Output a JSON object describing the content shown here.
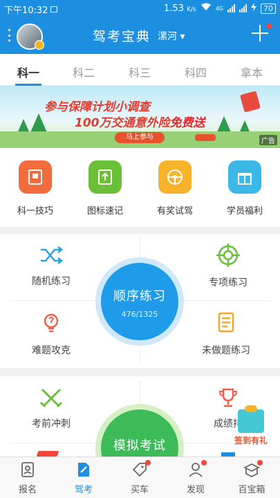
{
  "status_bar": {
    "time": "下午10:32",
    "speed": "1.53",
    "speed_unit": "K/s",
    "network": "4G",
    "battery": "70"
  },
  "header": {
    "title": "驾考宝典",
    "city": "漯河",
    "city_caret": "▾"
  },
  "tabs": [
    {
      "label": "科一",
      "active": true
    },
    {
      "label": "科二",
      "active": false
    },
    {
      "label": "科三",
      "active": false
    },
    {
      "label": "科四",
      "active": false
    },
    {
      "label": "拿本",
      "active": false
    }
  ],
  "banner": {
    "line1": "参与保障计划小调查",
    "line2_prefix": "100万交通意外险",
    "line2_highlight": "免费送",
    "button": "马上参与",
    "ad_tag": "广告"
  },
  "quick_items": [
    {
      "label": "科一技巧",
      "icon": "note-icon",
      "color": "#f36c3d"
    },
    {
      "label": "图标速记",
      "icon": "road-sign-icon",
      "color": "#6bc038"
    },
    {
      "label": "有奖试驾",
      "icon": "steering-wheel-icon",
      "color": "#f7b42a"
    },
    {
      "label": "学员福利",
      "icon": "gift-icon",
      "color": "#3bb8e8"
    }
  ],
  "practice": {
    "random": "随机练习",
    "special": "专项练习",
    "hard": "难题攻克",
    "undone": "未做题练习",
    "sequential": "顺序练习",
    "progress": "476/1325"
  },
  "mock": {
    "sprint": "考前冲刺",
    "ranking": "成绩排",
    "exam": "模拟考试",
    "sign_gift": "签到有礼"
  },
  "bottom_nav": [
    {
      "label": "报名",
      "icon": "id-card-icon",
      "active": false,
      "dot": false
    },
    {
      "label": "驾考",
      "icon": "edit-doc-icon",
      "active": true,
      "dot": false
    },
    {
      "label": "买车",
      "icon": "price-tag-icon",
      "active": false,
      "dot": true
    },
    {
      "label": "发现",
      "icon": "person-icon",
      "active": false,
      "dot": true
    },
    {
      "label": "百宝箱",
      "icon": "box-icon",
      "active": false,
      "dot": true
    }
  ],
  "colors": {
    "primary": "#1d8fe0",
    "sequential_circle": "#1f9ce9",
    "mock_circle": "#3dbb58",
    "badge_red": "#f5453a"
  }
}
